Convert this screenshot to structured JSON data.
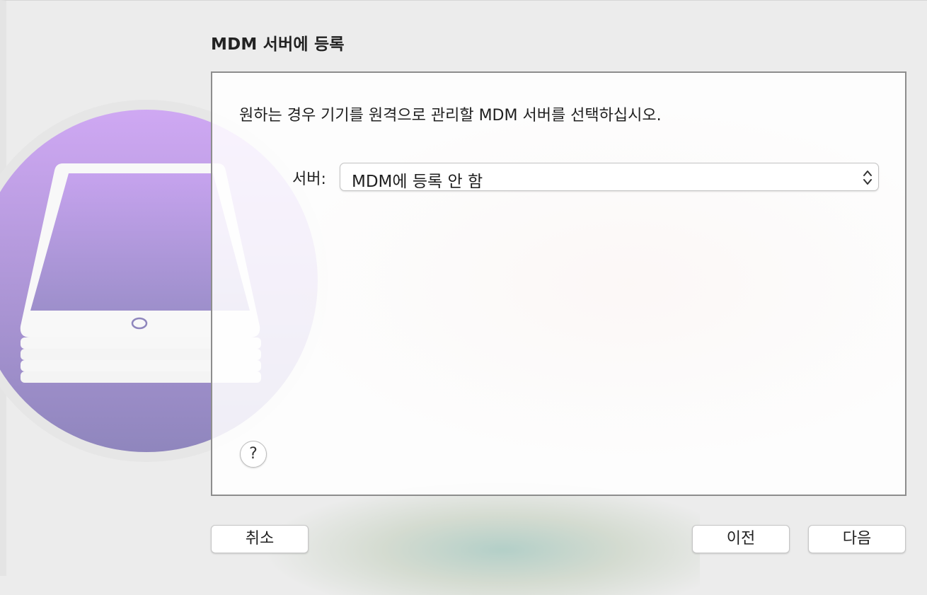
{
  "header": {
    "title": "MDM 서버에 등록"
  },
  "panel": {
    "instruction": "원하는 경우 기기를 원격으로 관리할 MDM 서버를 선택하십시오.",
    "server_label": "서버:",
    "server_selected": "MDM에 등록 안 함",
    "help_label": "?"
  },
  "footer": {
    "cancel_label": "취소",
    "previous_label": "이전",
    "next_label": "다음"
  },
  "icons": {
    "app_icon": "ipad-stack-icon",
    "stepper": "chevron-up-down-icon"
  },
  "colors": {
    "icon_purple_top": "#cfa8f3",
    "icon_purple_bottom": "#8f86bd",
    "window_background": "#ececec"
  }
}
